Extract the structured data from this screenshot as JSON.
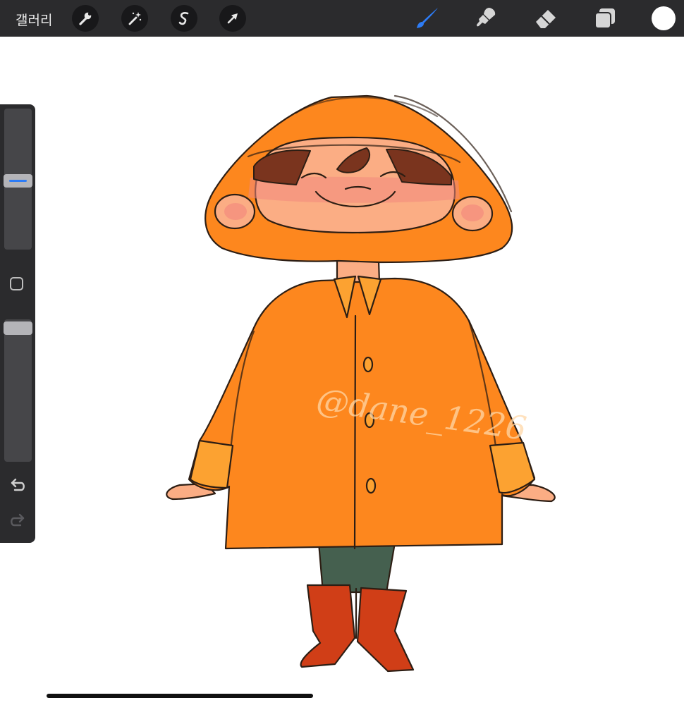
{
  "toolbar": {
    "gallery_label": "갤러리",
    "left_actions": [
      "wrench-icon",
      "magic-wand-icon",
      "selection-icon",
      "transform-arrow-icon"
    ],
    "tools": [
      "brush-icon",
      "smudge-icon",
      "eraser-icon",
      "layers-icon"
    ],
    "active_tool": "brush",
    "accent_color": "#2d7cf6",
    "current_color": "#ffffff"
  },
  "artwork": {
    "watermark": "@dane_1226",
    "palette": {
      "coat": "#fd871e",
      "cuff": "#fca231",
      "skin": "#fbad84",
      "blush": "#f3897d",
      "hair": "#7a341e",
      "pants": "#45604f",
      "boots": "#d03e17"
    }
  },
  "sidebar": {
    "brush_size_level": 0.5,
    "opacity_level": 0.97
  }
}
